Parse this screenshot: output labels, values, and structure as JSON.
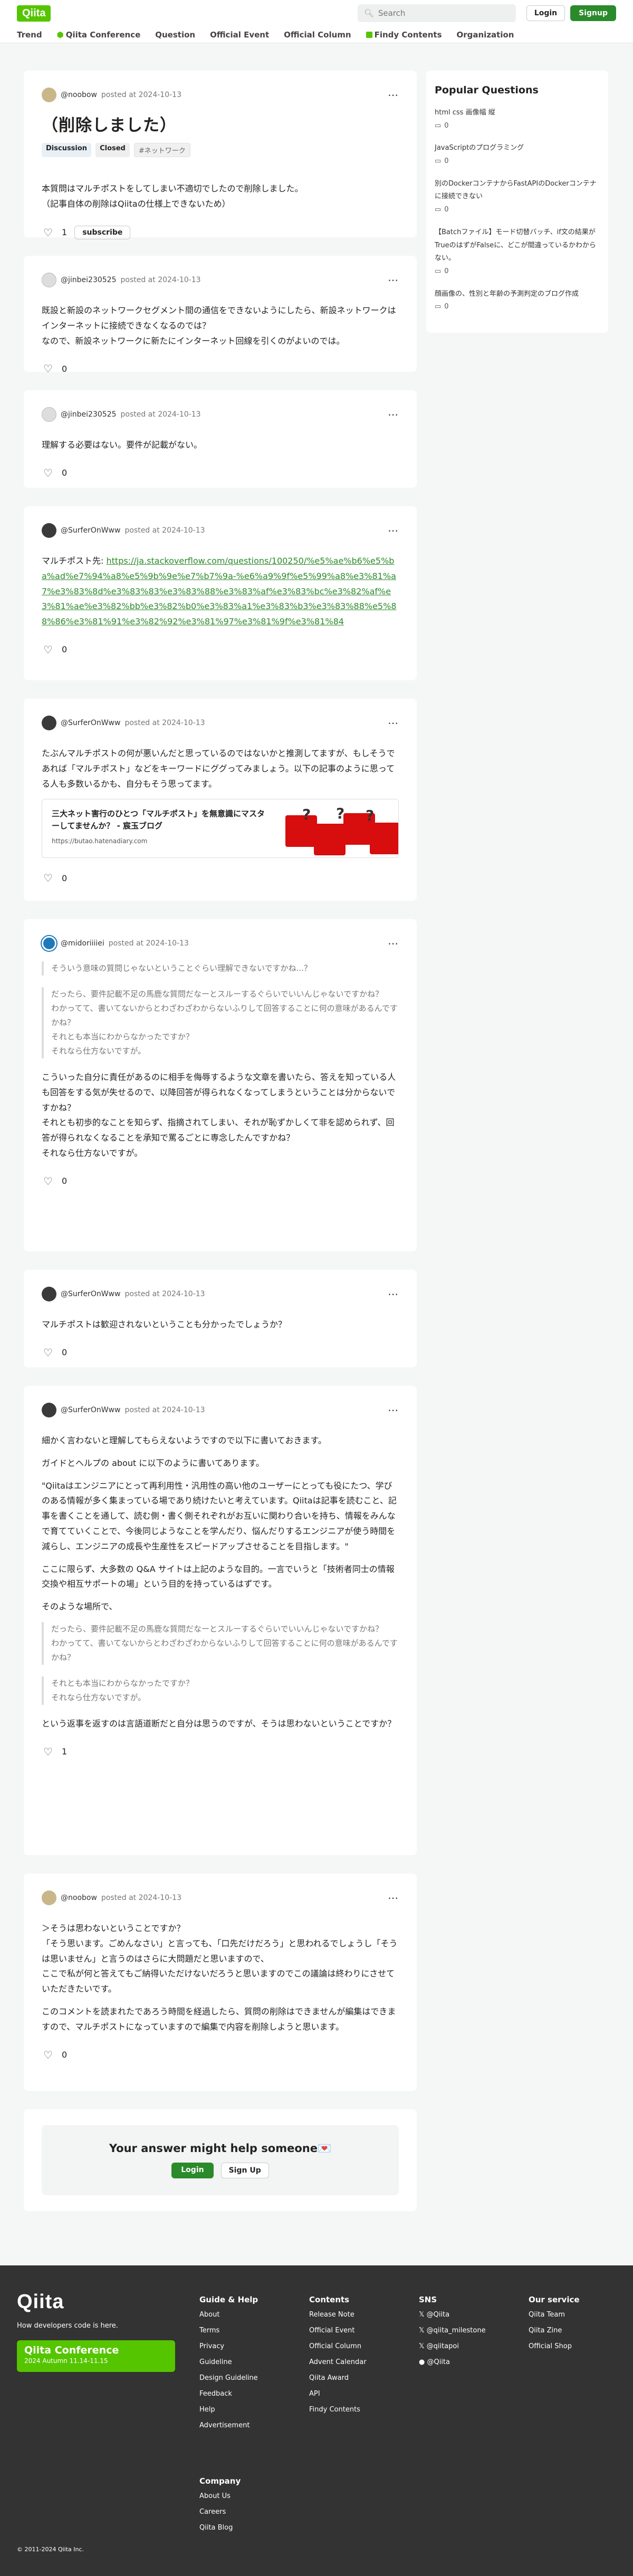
{
  "header": {
    "logo": "Qiita",
    "search_placeholder": "Search",
    "login": "Login",
    "signup": "Signup",
    "nav": [
      "Trend",
      "Qiita Conference",
      "Question",
      "Official Event",
      "Official Column",
      "Findy Contents",
      "Organization"
    ]
  },
  "question": {
    "author": "@noobow",
    "posted": "posted at 2024-10-13",
    "title": "（削除しました）",
    "tags": [
      "Discussion",
      "Closed",
      "ネットワーク"
    ],
    "body": [
      "本質問はマルチポストをしてしまい不適切でしたので削除しました。",
      "（記事自体の削除はQiitaの仕様上できないため）"
    ],
    "likes": "1",
    "subscribe": "subscribe"
  },
  "comments": [
    {
      "author": "@jinbei230525",
      "posted": "posted at 2024-10-13",
      "body": [
        "既設と新設のネットワークセグメント間の通信をできないようにしたら、新設ネットワークはインターネットに接続できなくなるのでは？",
        "なので、新設ネットワークに新たにインターネット回線を引くのがよいのでは。"
      ],
      "likes": "0"
    },
    {
      "author": "@jinbei230525",
      "posted": "posted at 2024-10-13",
      "body": [
        "理解する必要はない。要件が記載がない。"
      ],
      "likes": "0"
    },
    {
      "author": "@SurferOnWww",
      "posted": "posted at 2024-10-13",
      "lead": "マルチポスト先:",
      "link": "https://ja.stackoverflow.com/questions/100250/%e5%ae%b6%e5%ba%ad%e7%94%a8%e5%9b%9e%e7%b7%9a-%e6%a9%9f%e5%99%a8%e3%81%a7%e3%83%8d%e3%83%83%e3%83%88%e3%83%af%e3%83%bc%e3%82%af%e3%81%ae%e3%82%bb%e3%82%b0%e3%83%a1%e3%83%b3%e3%83%88%e5%88%86%e3%81%91%e3%82%92%e3%81%97%e3%81%9f%e3%81%84",
      "likes": "0"
    },
    {
      "author": "@SurferOnWww",
      "posted": "posted at 2024-10-13",
      "body": [
        "たぶんマルチポストの何が悪いんだと思っているのではないかと推測してますが、もしそうであれば「マルチポスト」などをキーワードにググってみましょう。以下の記事のように思ってる人も多数いるかも、自分もそう思ってます。"
      ],
      "ogp_title": "三大ネット害行のひとつ「マルチポスト」を無意識にマスターしてませんか？ - 宸玉ブログ",
      "ogp_host": "https://butao.hatenadiary.com",
      "likes": "0"
    },
    {
      "author": "@midoriiiiei",
      "posted": "posted at 2024-10-13",
      "quote1": [
        "そういう意味の質問じゃないということぐらい理解できないですかね...？"
      ],
      "quote2": [
        "だったら、要件記載不足の馬鹿な質問だなーとスルーするぐらいでいいんじゃないですかね？",
        "わかってて、書いてないからとわざわざわからないふりして回答することに何の意味があるんですかね？",
        "それとも本当にわからなかったですか？",
        "それなら仕方ないですが。"
      ],
      "body": [
        "こういった自分に責任があるのに相手を侮辱するような文章を書いたら、答えを知っている人も回答をする気が失せるので、以降回答が得られなくなってしまうということは分からないですかね？",
        "それとも初歩的なことを知らず、指摘されてしまい、それが恥ずかしくて非を認められず、回答が得られなくなることを承知で罵るごとに専念したんですかね？",
        "それなら仕方ないですが。"
      ],
      "likes": "0"
    },
    {
      "author": "@SurferOnWww",
      "posted": "posted at 2024-10-13",
      "body": [
        "マルチポストは歓迎されないということも分かったでしょうか？"
      ],
      "likes": "0"
    },
    {
      "author": "@SurferOnWww",
      "posted": "posted at 2024-10-13",
      "body1": [
        "細かく言わないと理解してもらえないようですので以下に書いておきます。",
        "ガイドとヘルプの about に以下のように書いてあります。",
        "\"Qiitaはエンジニアにとって再利用性・汎用性の高い他のユーザーにとっても役にたつ、学びのある情報が多く集まっている場であり続けたいと考えています。Qiitaは記事を読むこと、記事を書くことを通して、読む側・書く側それぞれがお互いに関わり合いを持ち、情報をみんなで育てていくことで、今後同じようなことを学んだり、悩んだりするエンジニアが使う時間を減らし、エンジニアの成長や生産性をスピードアップさせることを目指します。\"",
        "ここに限らず、大多数の Q&A サイトは上記のような目的。一言でいうと「技術者同士の情報交換や相互サポートの場」という目的を持っているはずです。",
        "そのような場所で、"
      ],
      "quote1": [
        "だったら、要件記載不足の馬鹿な質問だなーとスルーするぐらいでいいんじゃないですかね？",
        "わかってて、書いてないからとわざわざわからないふりして回答することに何の意味があるんですかね？"
      ],
      "quote2": [
        "それとも本当にわからなかったですか？",
        "それなら仕方ないですが。"
      ],
      "body2": [
        "という返事を返すのは言語道断だと自分は思うのですが、そうは思わないということですか？"
      ],
      "likes": "1"
    },
    {
      "author": "@noobow",
      "posted": "posted at 2024-10-13",
      "body": [
        "＞そうは思わないということですか？",
        "「そう思います。ごめんなさい」と言っても、「口先だけだろう」と思われるでしょうし「そうは思いません」と言うのはさらに大問題だと思いますので、",
        "ここで私が何と答えてもご納得いただけないだろうと思いますのでこの議論は終わりにさせていただきたいです。",
        "このコメントを読まれたであろう時間を経過したら、質問の削除はできませんが編集はできますので、マルチポストになっていますので編集で内容を削除しようと思います。"
      ],
      "likes": "0"
    }
  ],
  "cta": {
    "title": "Your answer might help someone💌",
    "login": "Login",
    "signup": "Sign Up"
  },
  "popular": {
    "title": "Popular Questions",
    "items": [
      {
        "text": "html css 画像幅 縦",
        "count": "0"
      },
      {
        "text": "JavaScriptのプログラミング",
        "count": "0"
      },
      {
        "text": "別のDockerコンテナからFastAPIのDockerコンテナに接続できない",
        "count": "0"
      },
      {
        "text": "【Batchファイル】モード切替バッチ、if文の結果がTrueのはずがFalseに、どこが間違っているかわからない。",
        "count": "0"
      },
      {
        "text": "顔画像の、性別と年齢の予測判定のブログ作成",
        "count": "0"
      }
    ]
  },
  "footer": {
    "logo": "Qiita",
    "tagline": "How developers code is here.",
    "banner_title": "Qiita Conference",
    "banner_sub": "2024 Autumn 11.14-11.15",
    "copyright": "© 2011-2024 Qiita Inc.",
    "columns": [
      {
        "title": "Guide & Help",
        "links": [
          "About",
          "Terms",
          "Privacy",
          "Guideline",
          "Design Guideline",
          "Feedback",
          "Help",
          "Advertisement"
        ]
      },
      {
        "title": "Contents",
        "links": [
          "Release Note",
          "Official Event",
          "Official Column",
          "Advent Calendar",
          "Qiita Award",
          "API",
          "Findy Contents"
        ]
      },
      {
        "title": "SNS",
        "links": [
          "𝕏 @Qiita",
          "𝕏 @qiita_milestone",
          "𝕏 @qiitapoi",
          "● @Qiita"
        ]
      },
      {
        "title": "Our service",
        "links": [
          "Qiita Team",
          "Qiita Zine",
          "Official Shop"
        ]
      },
      {
        "title": "Company",
        "links": [
          "About Us",
          "Careers",
          "Qiita Blog"
        ]
      }
    ]
  }
}
